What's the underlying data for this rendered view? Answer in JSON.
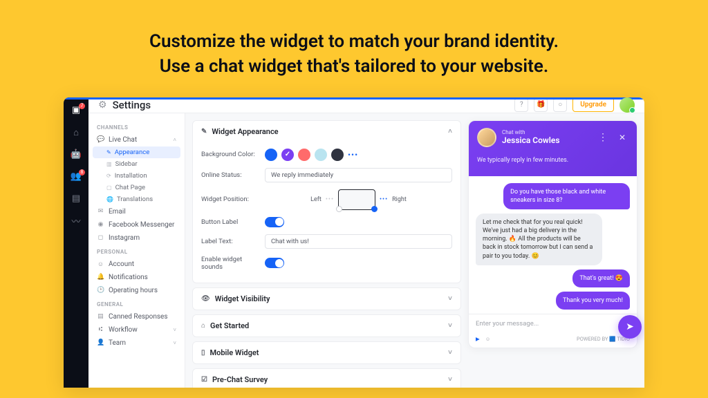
{
  "hero": {
    "line1": "Customize the widget to match your brand identity.",
    "line2": "Use a chat widget that's tailored to your website."
  },
  "topbar": {
    "title": "Settings",
    "upgrade": "Upgrade"
  },
  "rail": {
    "badge1": "7",
    "badge2": "8"
  },
  "sidebar": {
    "hdr_channels": "CHANNELS",
    "live_chat": "Live Chat",
    "appearance": "Appearance",
    "sidebar": "Sidebar",
    "installation": "Installation",
    "chat_page": "Chat Page",
    "translations": "Translations",
    "email": "Email",
    "messenger": "Facebook Messenger",
    "instagram": "Instagram",
    "hdr_personal": "PERSONAL",
    "account": "Account",
    "notifications": "Notifications",
    "hours": "Operating hours",
    "hdr_general": "GENERAL",
    "canned": "Canned Responses",
    "workflow": "Workflow",
    "team": "Team"
  },
  "cards": {
    "widget_appearance": "Widget Appearance",
    "widget_visibility": "Widget Visibility",
    "get_started": "Get Started",
    "mobile_widget": "Mobile Widget",
    "prechat": "Pre-Chat Survey"
  },
  "form": {
    "bg_color": "Background Color:",
    "online_status": "Online Status:",
    "online_status_val": "We reply immediately",
    "widget_position": "Widget Position:",
    "left": "Left",
    "right": "Right",
    "button_label": "Button Label",
    "label_text": "Label Text:",
    "label_text_val": "Chat with us!",
    "enable_sounds": "Enable widget sounds",
    "swatches": [
      "#1663F6",
      "#7B3FF2",
      "#FF6B6B",
      "#B9E4F0",
      "#2F3340"
    ]
  },
  "chat": {
    "pre": "Chat with",
    "name": "Jessica Cowles",
    "sub": "We typically reply in few minutes.",
    "msg1": "Do you have those black and white sneakers in size 8?",
    "msg2": "Let me check that for you real quick! We've just had a big delivery in the morning. 🔥 All the products will be back in stock tomorrow but I can send a pair to you today. 😊",
    "msg3": "That's great! 😍",
    "msg4": "Thank you very much!",
    "placeholder": "Enter your message...",
    "powered": "POWERED BY 🟦 TIDIO"
  }
}
